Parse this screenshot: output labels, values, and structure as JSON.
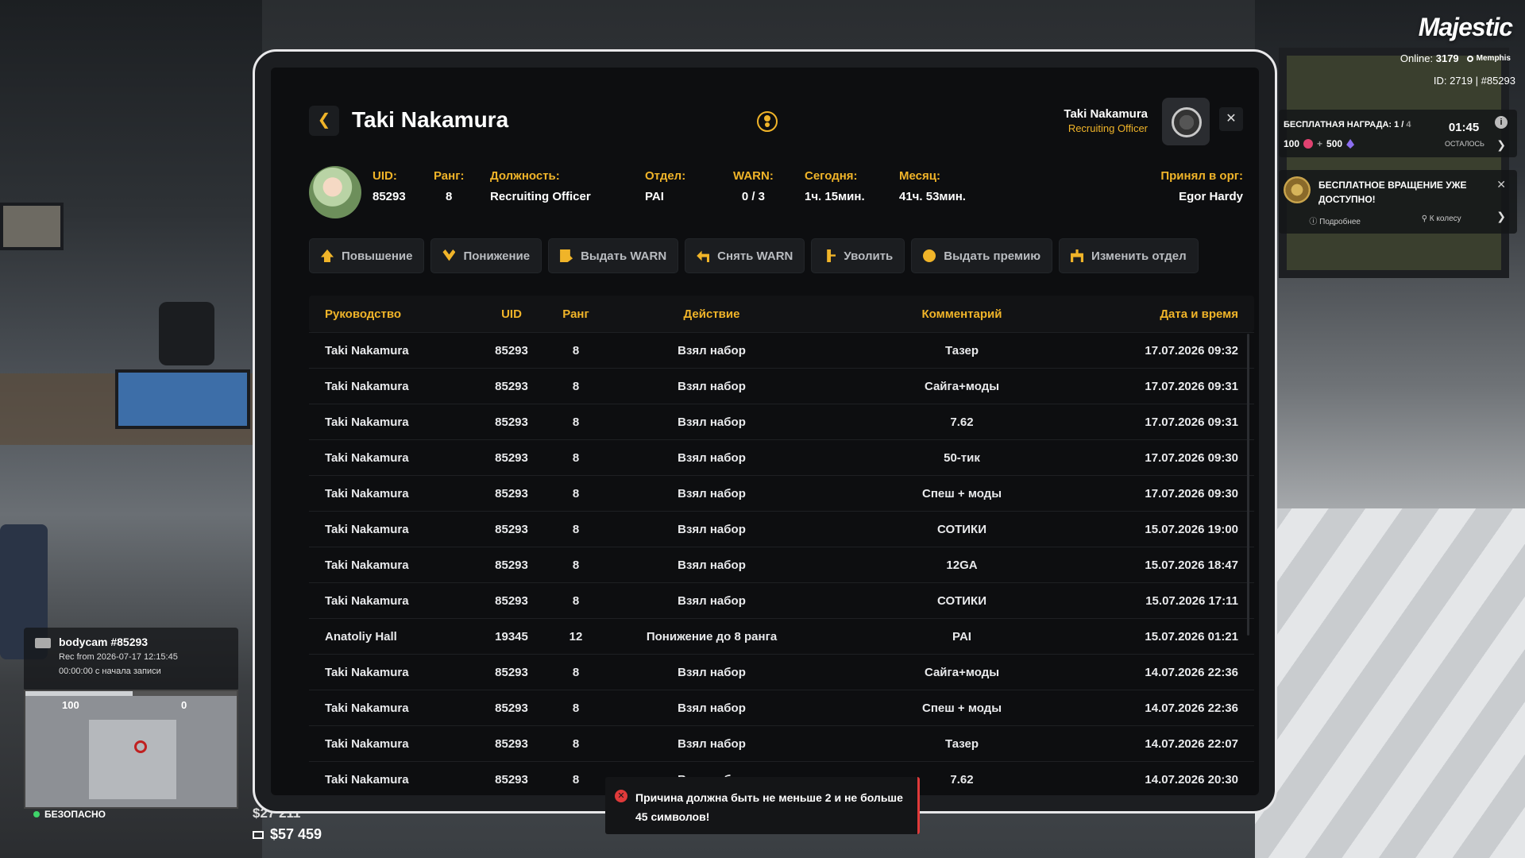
{
  "hud": {
    "brand": "Majestic",
    "online_label": "Online:",
    "online_count": "3179",
    "server": "Memphis",
    "id_line": "ID: 2719 | #85293",
    "reward": {
      "title": "БЕСПЛАТНАЯ НАГРАДА: 1 /",
      "title_total": "4",
      "coins": "100",
      "plus": "+",
      "gems": "500",
      "timer": "01:45",
      "timer_label": "ОСТАЛОСЬ"
    },
    "spin": {
      "text": "БЕСПЛАТНОЕ ВРАЩЕНИЕ УЖЕ ДОСТУПНО!",
      "details": "Подробнее",
      "to_wheel": "К колесу"
    },
    "bodycam": {
      "title": "bodycam #85293",
      "rec": "Rec from 2026-07-17 12:15:45",
      "elapsed": "00:00:00 с начала записи"
    },
    "health": "100",
    "armor": "0",
    "zone": "БЕЗОПАСНО",
    "cash": "$27 211",
    "bank": "$57 459"
  },
  "profile": {
    "name": "Taki Nakamura",
    "viewer_name": "Taki Nakamura",
    "viewer_role": "Recruiting Officer",
    "fields": [
      {
        "label": "UID:",
        "value": "85293"
      },
      {
        "label": "Ранг:",
        "value": "8"
      },
      {
        "label": "Должность:",
        "value": "Recruiting Officer"
      },
      {
        "label": "Отдел:",
        "value": "PAI"
      },
      {
        "label": "WARN:",
        "value": "0 / 3"
      },
      {
        "label": "Сегодня:",
        "value": "1ч. 15мин."
      },
      {
        "label": "Месяц:",
        "value": "41ч. 53мин."
      },
      {
        "label": "Принял в орг:",
        "value": "Egor Hardy"
      }
    ]
  },
  "actions": [
    {
      "label": "Повышение",
      "icon": "arrow-up-icon"
    },
    {
      "label": "Понижение",
      "icon": "arrow-down-icon"
    },
    {
      "label": "Выдать WARN",
      "icon": "warn-icon"
    },
    {
      "label": "Снять WARN",
      "icon": "undo-icon"
    },
    {
      "label": "Уволить",
      "icon": "fire-icon"
    },
    {
      "label": "Выдать премию",
      "icon": "coin-icon"
    },
    {
      "label": "Изменить отдел",
      "icon": "department-icon"
    }
  ],
  "table": {
    "headers": [
      "Руководство",
      "UID",
      "Ранг",
      "Действие",
      "Комментарий",
      "Дата и время"
    ],
    "rows": [
      [
        "Taki Nakamura",
        "85293",
        "8",
        "Взял набор",
        "Тазер",
        "17.07.2026 09:32"
      ],
      [
        "Taki Nakamura",
        "85293",
        "8",
        "Взял набор",
        "Сайга+моды",
        "17.07.2026 09:31"
      ],
      [
        "Taki Nakamura",
        "85293",
        "8",
        "Взял набор",
        "7.62",
        "17.07.2026 09:31"
      ],
      [
        "Taki Nakamura",
        "85293",
        "8",
        "Взял набор",
        "50-тик",
        "17.07.2026 09:30"
      ],
      [
        "Taki Nakamura",
        "85293",
        "8",
        "Взял набор",
        "Спеш + моды",
        "17.07.2026 09:30"
      ],
      [
        "Taki Nakamura",
        "85293",
        "8",
        "Взял набор",
        "СОТИКИ",
        "15.07.2026 19:00"
      ],
      [
        "Taki Nakamura",
        "85293",
        "8",
        "Взял набор",
        "12GA",
        "15.07.2026 18:47"
      ],
      [
        "Taki Nakamura",
        "85293",
        "8",
        "Взял набор",
        "СОТИКИ",
        "15.07.2026 17:11"
      ],
      [
        "Anatoliy Hall",
        "19345",
        "12",
        "Понижение до 8 ранга",
        "PAI",
        "15.07.2026 01:21"
      ],
      [
        "Taki Nakamura",
        "85293",
        "8",
        "Взял набор",
        "Сайга+моды",
        "14.07.2026 22:36"
      ],
      [
        "Taki Nakamura",
        "85293",
        "8",
        "Взял набор",
        "Спеш + моды",
        "14.07.2026 22:36"
      ],
      [
        "Taki Nakamura",
        "85293",
        "8",
        "Взял набор",
        "Тазер",
        "14.07.2026 22:07"
      ],
      [
        "Taki Nakamura",
        "85293",
        "8",
        "Взял набор",
        "7.62",
        "14.07.2026 20:30"
      ]
    ]
  },
  "toast": {
    "message": "Причина должна быть не меньше 2 и не больше 45 символов!"
  },
  "colors": {
    "accent": "#f0b429",
    "panel": "#0d0e10",
    "error": "#e03a3a"
  }
}
